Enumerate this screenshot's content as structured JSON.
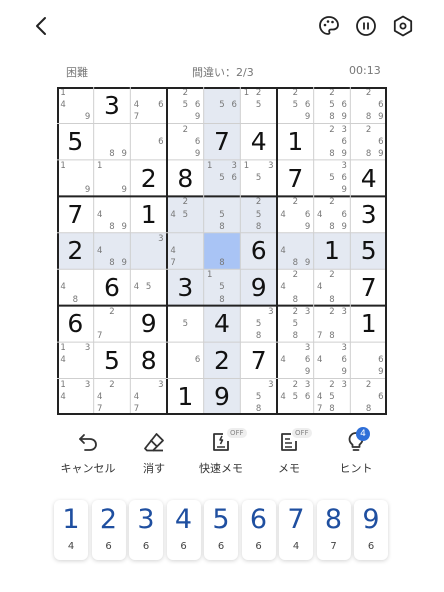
{
  "topbar": {
    "back_icon": "chevron-left-icon",
    "theme_icon": "palette-icon",
    "pause_icon": "pause-icon",
    "settings_icon": "gear-icon"
  },
  "status": {
    "difficulty": "困難",
    "mistakes": "間違い：2/3",
    "timer": "00:13"
  },
  "colors": {
    "selected": "#a9c4f5",
    "highlight": "#e4e9f2",
    "digit": "#1f4fa0",
    "badge": "#2f6fd8"
  },
  "board": {
    "cells": [
      [
        "n:149",
        "v:3",
        "n:467",
        "n:2569",
        "n:56",
        "n:125",
        "n:2569",
        "n:25689",
        "n:2689"
      ],
      [
        "v:5",
        "n:89",
        "n:6",
        "n:269",
        "v:7",
        "v:4",
        "v:1",
        "n:23689",
        "n:2689"
      ],
      [
        "n:19",
        "n:19",
        "v:2",
        "v:8",
        "n:1356",
        "n:135",
        "v:7",
        "n:3569",
        "v:4"
      ],
      [
        "v:7",
        "n:489",
        "v:1",
        "n:245",
        "n:58",
        "n:258",
        "n:2469",
        "n:24689",
        "v:3"
      ],
      [
        "v:2",
        "n:489",
        "n:3",
        "n:47",
        "n:8",
        "v:6",
        "n:489",
        "v:1",
        "v:5"
      ],
      [
        "n:48",
        "v:6",
        "n:45",
        "v:3",
        "n:158",
        "v:9",
        "n:248",
        "n:248",
        "v:7"
      ],
      [
        "v:6",
        "n:27",
        "v:9",
        "n:5",
        "v:4",
        "n:358",
        "n:2358",
        "n:2378",
        "v:1"
      ],
      [
        "n:134",
        "v:5",
        "v:8",
        "n:6",
        "v:2",
        "v:7",
        "n:3469",
        "n:3469",
        "n:69"
      ],
      [
        "n:134",
        "n:247",
        "n:347",
        "v:1",
        "v:9",
        "n:358",
        "n:23456",
        "n:234578",
        "n:268"
      ]
    ],
    "selected": [
      4,
      4
    ]
  },
  "tools": [
    {
      "label": "キャンセル",
      "icon": "undo-icon"
    },
    {
      "label": "消す",
      "icon": "eraser-icon"
    },
    {
      "label": "快速メモ",
      "icon": "quick-note-icon",
      "badge": "OFF"
    },
    {
      "label": "メモ",
      "icon": "note-icon",
      "badge": "OFF"
    },
    {
      "label": "ヒント",
      "icon": "lightbulb-icon",
      "count": "4"
    }
  ],
  "numpad": [
    {
      "digit": "1",
      "remaining": "4"
    },
    {
      "digit": "2",
      "remaining": "6"
    },
    {
      "digit": "3",
      "remaining": "6"
    },
    {
      "digit": "4",
      "remaining": "6"
    },
    {
      "digit": "5",
      "remaining": "6"
    },
    {
      "digit": "6",
      "remaining": "6"
    },
    {
      "digit": "7",
      "remaining": "4"
    },
    {
      "digit": "8",
      "remaining": "7"
    },
    {
      "digit": "9",
      "remaining": "6"
    }
  ]
}
